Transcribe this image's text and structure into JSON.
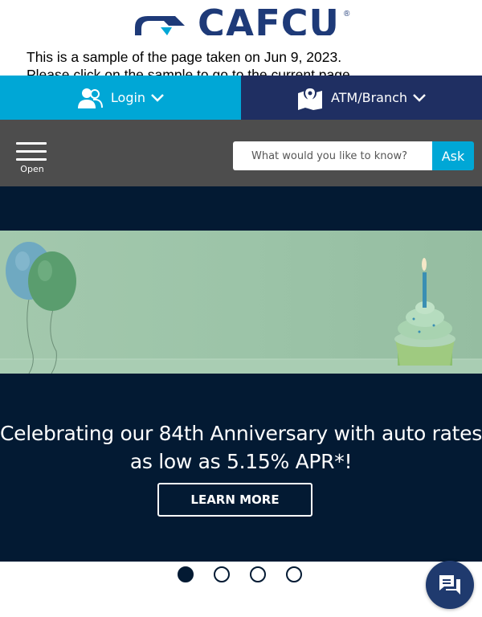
{
  "brand": {
    "name": "CAFCU",
    "reg_mark": "®",
    "primary_color": "#1e3a78",
    "accent_color": "#00a7d6"
  },
  "sample_notice": {
    "line1": "This is a sample of the page taken on Jun 9, 2023.",
    "line2": "Please click on the sample to go to the current page."
  },
  "top_buttons": {
    "login": {
      "label": "Login",
      "icon": "users-icon",
      "chevron": "chevron-down-icon"
    },
    "atm": {
      "label": "ATM/Branch",
      "icon": "map-pin-icon",
      "chevron": "chevron-down-icon"
    }
  },
  "nav": {
    "menu_label": "Open",
    "menu_icon": "hamburger-icon"
  },
  "search": {
    "placeholder": "What would you like to know?",
    "button_label": "Ask"
  },
  "hero": {
    "headline": "Celebrating our 84th Anniversary with auto rates as low as 5.15% APR*!",
    "cta_label": "LEARN MORE",
    "background": "#031a33"
  },
  "carousel": {
    "slides": 4,
    "active_index": 0
  },
  "chat": {
    "icon": "chat-icon"
  }
}
